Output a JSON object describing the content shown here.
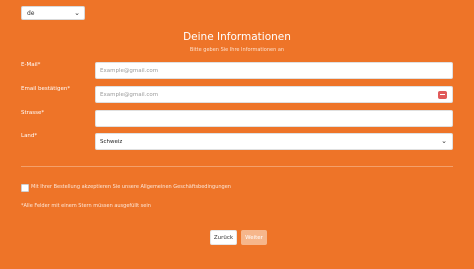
{
  "language": {
    "selected": "de",
    "chevron_icon": "chevron-down-icon"
  },
  "header": {
    "title": "Deine Informationen",
    "subtitle": "Bitte geben Sie Ihre Informationen an"
  },
  "form": {
    "email": {
      "label": "E-Mail*",
      "value": "",
      "placeholder": "Example@gmail.com"
    },
    "email_confirm": {
      "label": "Email bestätigen*",
      "value": "",
      "placeholder": "Example@gmail.com",
      "badge_icon": "password-manager-icon"
    },
    "street": {
      "label": "Strasse*",
      "value": "",
      "placeholder": ""
    },
    "country": {
      "label": "Land*",
      "value": "Schweiz",
      "chevron_icon": "chevron-down-icon"
    }
  },
  "terms": {
    "checked": false,
    "text": "Mit Ihrer Bestellung akzeptieren Sie unsere Allgemeinen Geschäftsbedingungen"
  },
  "note": "*Alle Felder mit einem Stern müssen ausgefüllt sein",
  "buttons": {
    "back": "Zurück",
    "next": "Weiter"
  },
  "colors": {
    "background": "#ee7428",
    "next_button": "#f6b68b",
    "badge": "#e05a5a"
  }
}
